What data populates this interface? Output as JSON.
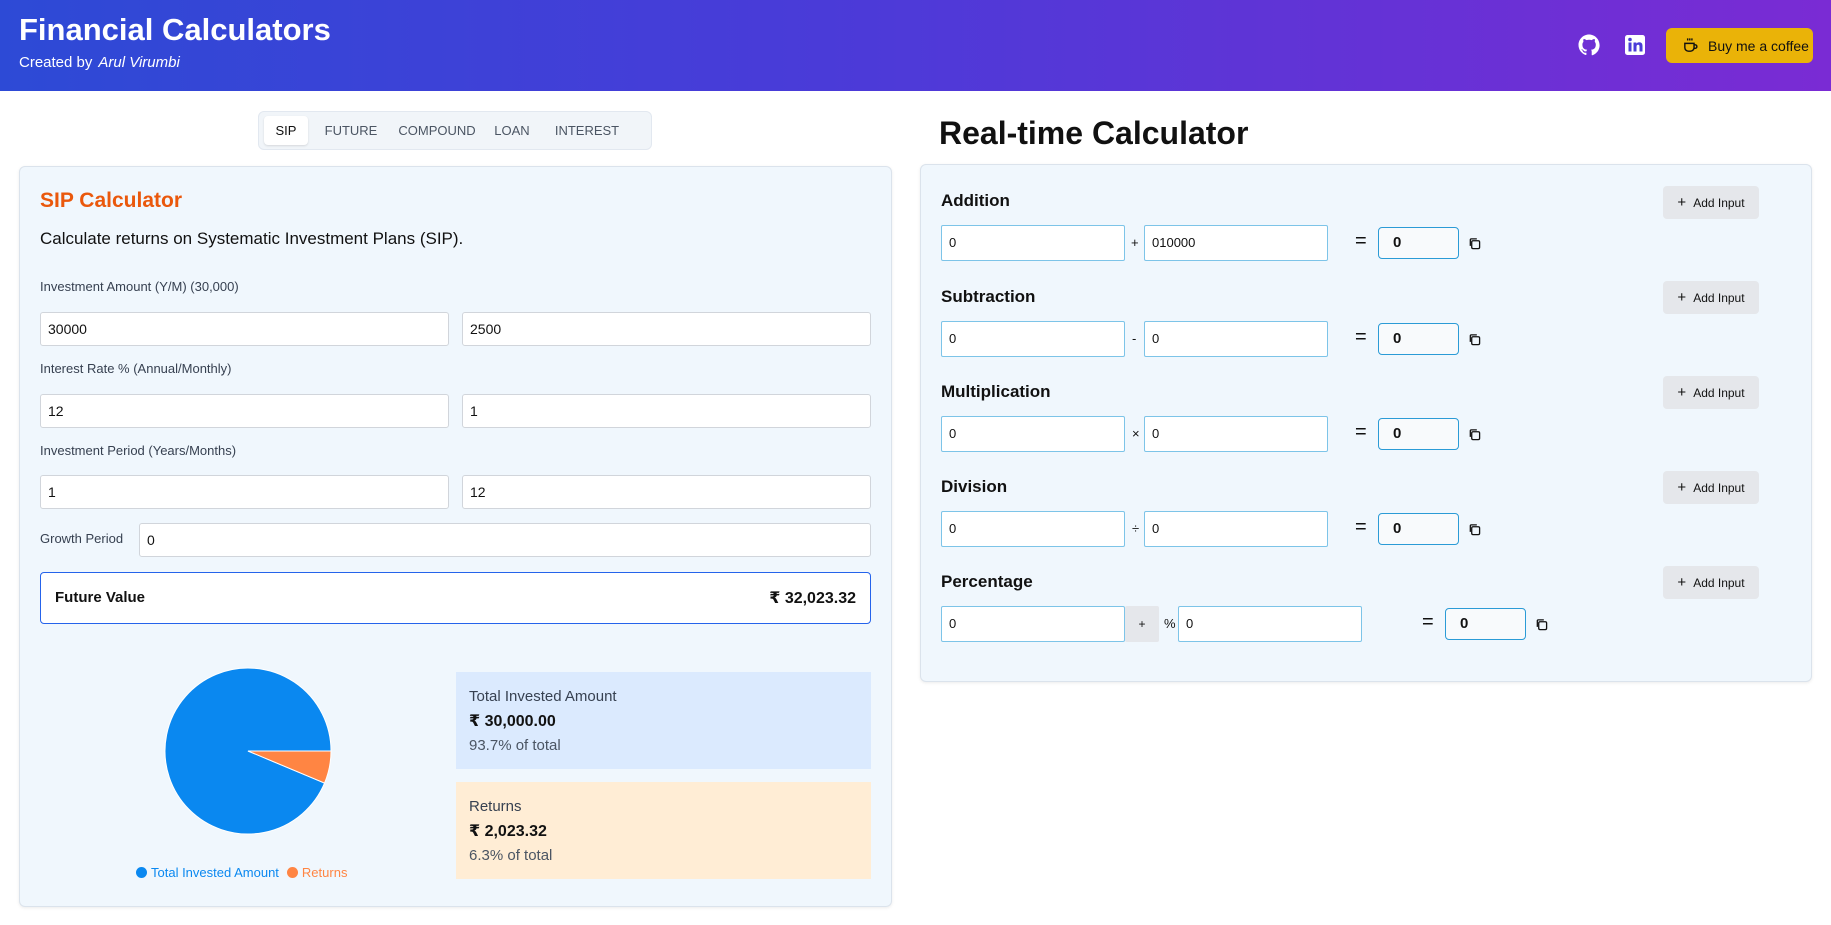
{
  "header": {
    "title": "Financial Calculators",
    "created_by": "Created by",
    "author": "Arul Virumbi",
    "coffee_label": "Buy me a coffee",
    "icons": [
      "github-icon",
      "linkedin-icon",
      "coffee-icon"
    ]
  },
  "tabs": [
    "SIP",
    "FUTURE",
    "COMPOUND",
    "LOAN",
    "INTEREST"
  ],
  "active_tab": "SIP",
  "sip": {
    "title": "SIP Calculator",
    "description": "Calculate returns on Systematic Investment Plans (SIP).",
    "investment_label": "Investment Amount (Y/M) (30,000)",
    "investment_yearly": "30000",
    "investment_monthly": "2500",
    "rate_label": "Interest Rate % (Annual/Monthly)",
    "rate_annual": "12",
    "rate_monthly": "1",
    "period_label": "Investment Period (Years/Months)",
    "period_years": "1",
    "period_months": "12",
    "growth_label": "Growth Period",
    "growth_value": "0",
    "future_value_label": "Future Value",
    "future_value": "₹ 32,023.32",
    "invested_label": "Total Invested Amount",
    "invested_value": "₹ 30,000.00",
    "invested_pct": "93.7% of total",
    "returns_label": "Returns",
    "returns_value": "₹ 2,023.32",
    "returns_pct": "6.3% of total",
    "legend_invested": "Total Invested Amount",
    "legend_returns": "Returns"
  },
  "chart_data": {
    "type": "pie",
    "categories": [
      "Total Invested Amount",
      "Returns"
    ],
    "values": [
      30000.0,
      2023.32
    ],
    "colors": [
      "#0a88f0",
      "#ff8543"
    ]
  },
  "realtime": {
    "title": "Real-time Calculator",
    "add_input_label": "Add Input",
    "operations": [
      {
        "label": "Addition",
        "a": "0",
        "symbol": "+",
        "b": "010000",
        "result": "0"
      },
      {
        "label": "Subtraction",
        "a": "0",
        "symbol": "-",
        "b": "0",
        "result": "0"
      },
      {
        "label": "Multiplication",
        "a": "0",
        "symbol": "×",
        "b": "0",
        "result": "0"
      },
      {
        "label": "Division",
        "a": "0",
        "symbol": "÷",
        "b": "0",
        "result": "0"
      }
    ],
    "percentage": {
      "label": "Percentage",
      "a": "0",
      "toggle": "+",
      "symbol": "%",
      "b": "0",
      "result": "0"
    }
  }
}
